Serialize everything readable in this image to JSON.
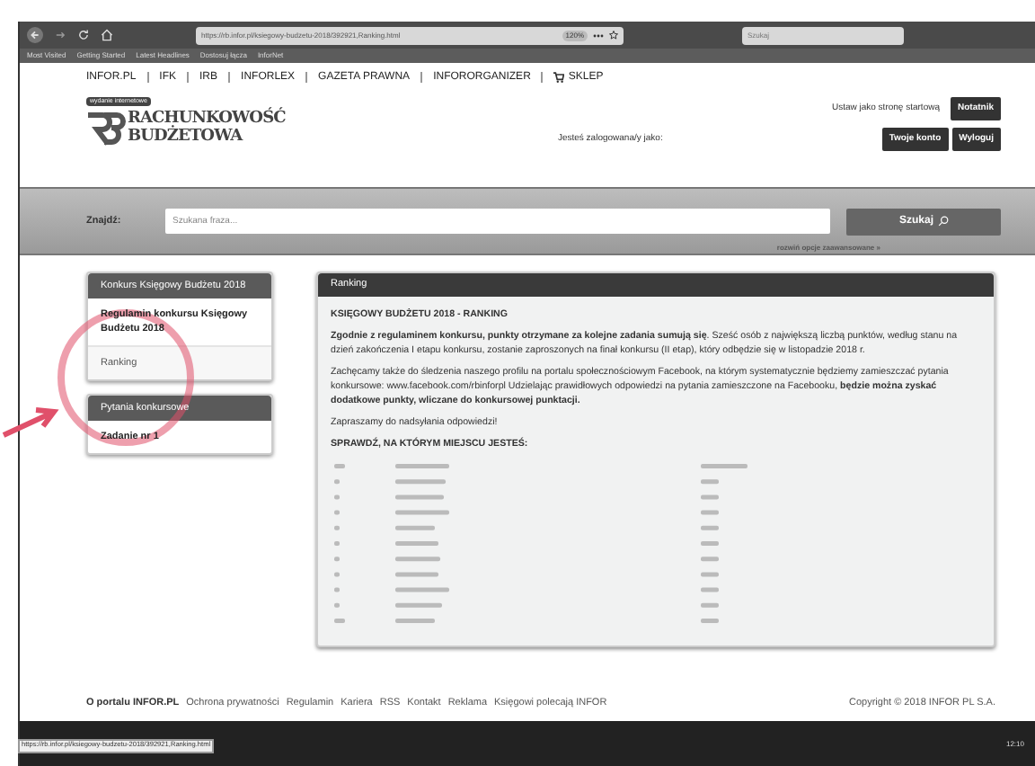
{
  "browser": {
    "url": "https://rb.infor.pl/ksiegowy-budzetu-2018/392921,Ranking.html",
    "zoom": "120%",
    "search_placeholder": "Szukaj",
    "bookmarks": [
      "Most Visited",
      "Getting Started",
      "Latest Headlines",
      "Dostosuj łącza",
      "InforNet"
    ]
  },
  "top_nav": [
    "INFOR.PL",
    "IFK",
    "IRB",
    "INFORLEX",
    "GAZETA PRAWNA",
    "INFORORGANIZER",
    "SKLEP"
  ],
  "header": {
    "badge": "wydanie internetowe",
    "logo_lines": [
      "RACHUNKOWOŚĆ",
      "BUDŻETOWA"
    ],
    "set_home": "Ustaw jako stronę startową",
    "notes_button": "Notatnik",
    "logged_in": "Jesteś zalogowana/y jako:",
    "account_button": "Twoje konto",
    "logout_button": "Wyloguj"
  },
  "search": {
    "label": "Znajdź:",
    "placeholder": "Szukana fraza...",
    "button": "Szukaj",
    "advanced": "rozwiń opcje zaawansowane »"
  },
  "sidebar": [
    {
      "title": "Konkurs Księgowy Budżetu 2018",
      "items": [
        {
          "label": "Regulamin konkursu Księgowy Budżetu 2018",
          "selected": false
        },
        {
          "label": "Ranking",
          "selected": true
        }
      ]
    },
    {
      "title": "Pytania konkursowe",
      "items": [
        {
          "label": "Zadanie nr 1",
          "selected": false
        }
      ]
    }
  ],
  "main": {
    "title": "Ranking",
    "heading": "KSIĘGOWY BUDŻETU 2018 - RANKING",
    "paragraphs": [
      "**Zgodnie z regulaminem konkursu, punkty otrzymane za kolejne zadania sumują się**. Sześć osób z największą liczbą punktów, według stanu na dzień zakończenia I etapu konkursu, zostanie zaproszonych na finał konkursu (II etap), który odbędzie się w listopadzie 2018 r.",
      "Zachęcamy także do śledzenia naszego profilu na portalu społecznościowym Facebook, na którym systematycznie będziemy zamieszczać pytania konkursowe: www.facebook.com/rbinforpl Udzielając prawidłowych odpowiedzi na pytania zamieszczone na Facebooku, **będzie można zyskać dodatkowe punkty, wliczane do konkursowej punktacji.**",
      "Zapraszamy do nadsyłania odpowiedzi!"
    ],
    "subheading": "SPRAWDŹ, NA KTÓRYM MIEJSCU JESTEŚ:"
  },
  "footer": {
    "links": [
      "O portalu INFOR.PL",
      "Ochrona prywatności",
      "Regulamin",
      "Kariera",
      "RSS",
      "Kontakt",
      "Reklama",
      "Księgowi polecają INFOR"
    ],
    "copyright": "Copyright © 2018 INFOR PL S.A."
  },
  "status_url": "https://rb.infor.pl/ksiegowy-budzetu-2018/392921,Ranking.html",
  "taskbar_time": "12:10"
}
